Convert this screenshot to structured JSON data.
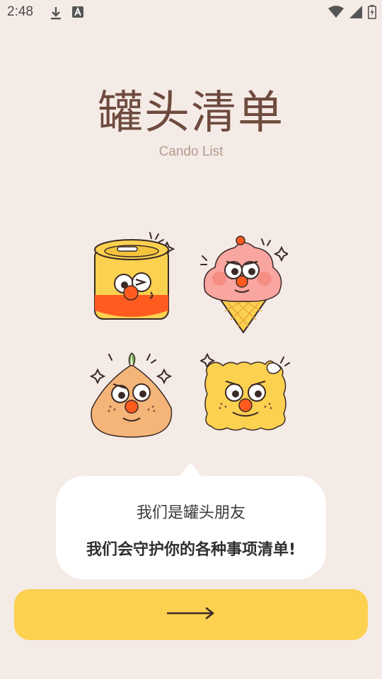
{
  "status_bar": {
    "time": "2:48",
    "left_icons": [
      "download-icon",
      "a-badge-icon"
    ],
    "right_icons": [
      "wifi-icon",
      "cell-signal-icon",
      "battery-charging-icon"
    ]
  },
  "header": {
    "title": "罐头清单",
    "subtitle": "Cando List"
  },
  "mascots": [
    "can-mascot",
    "ice-cream-mascot",
    "onion-mascot",
    "cracker-mascot"
  ],
  "bubble": {
    "line1": "我们是罐头朋友",
    "line2": "我们会守护你的各种事项清单!"
  },
  "next_button": {
    "icon": "arrow-right-icon"
  },
  "colors": {
    "background": "#F5EBE6",
    "title": "#6E4B3E",
    "subtitle": "#B39A8D",
    "button": "#FCD14F",
    "accent_orange": "#FF5B1F"
  }
}
